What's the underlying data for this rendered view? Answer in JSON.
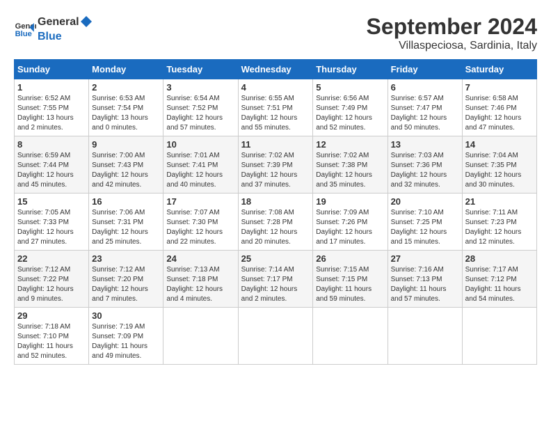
{
  "header": {
    "logo_general": "General",
    "logo_blue": "Blue",
    "month_year": "September 2024",
    "location": "Villaspeciosa, Sardinia, Italy"
  },
  "calendar": {
    "days_of_week": [
      "Sunday",
      "Monday",
      "Tuesday",
      "Wednesday",
      "Thursday",
      "Friday",
      "Saturday"
    ],
    "weeks": [
      [
        {
          "day": "1",
          "info": "Sunrise: 6:52 AM\nSunset: 7:55 PM\nDaylight: 13 hours\nand 2 minutes."
        },
        {
          "day": "2",
          "info": "Sunrise: 6:53 AM\nSunset: 7:54 PM\nDaylight: 13 hours\nand 0 minutes."
        },
        {
          "day": "3",
          "info": "Sunrise: 6:54 AM\nSunset: 7:52 PM\nDaylight: 12 hours\nand 57 minutes."
        },
        {
          "day": "4",
          "info": "Sunrise: 6:55 AM\nSunset: 7:51 PM\nDaylight: 12 hours\nand 55 minutes."
        },
        {
          "day": "5",
          "info": "Sunrise: 6:56 AM\nSunset: 7:49 PM\nDaylight: 12 hours\nand 52 minutes."
        },
        {
          "day": "6",
          "info": "Sunrise: 6:57 AM\nSunset: 7:47 PM\nDaylight: 12 hours\nand 50 minutes."
        },
        {
          "day": "7",
          "info": "Sunrise: 6:58 AM\nSunset: 7:46 PM\nDaylight: 12 hours\nand 47 minutes."
        }
      ],
      [
        {
          "day": "8",
          "info": "Sunrise: 6:59 AM\nSunset: 7:44 PM\nDaylight: 12 hours\nand 45 minutes."
        },
        {
          "day": "9",
          "info": "Sunrise: 7:00 AM\nSunset: 7:43 PM\nDaylight: 12 hours\nand 42 minutes."
        },
        {
          "day": "10",
          "info": "Sunrise: 7:01 AM\nSunset: 7:41 PM\nDaylight: 12 hours\nand 40 minutes."
        },
        {
          "day": "11",
          "info": "Sunrise: 7:02 AM\nSunset: 7:39 PM\nDaylight: 12 hours\nand 37 minutes."
        },
        {
          "day": "12",
          "info": "Sunrise: 7:02 AM\nSunset: 7:38 PM\nDaylight: 12 hours\nand 35 minutes."
        },
        {
          "day": "13",
          "info": "Sunrise: 7:03 AM\nSunset: 7:36 PM\nDaylight: 12 hours\nand 32 minutes."
        },
        {
          "day": "14",
          "info": "Sunrise: 7:04 AM\nSunset: 7:35 PM\nDaylight: 12 hours\nand 30 minutes."
        }
      ],
      [
        {
          "day": "15",
          "info": "Sunrise: 7:05 AM\nSunset: 7:33 PM\nDaylight: 12 hours\nand 27 minutes."
        },
        {
          "day": "16",
          "info": "Sunrise: 7:06 AM\nSunset: 7:31 PM\nDaylight: 12 hours\nand 25 minutes."
        },
        {
          "day": "17",
          "info": "Sunrise: 7:07 AM\nSunset: 7:30 PM\nDaylight: 12 hours\nand 22 minutes."
        },
        {
          "day": "18",
          "info": "Sunrise: 7:08 AM\nSunset: 7:28 PM\nDaylight: 12 hours\nand 20 minutes."
        },
        {
          "day": "19",
          "info": "Sunrise: 7:09 AM\nSunset: 7:26 PM\nDaylight: 12 hours\nand 17 minutes."
        },
        {
          "day": "20",
          "info": "Sunrise: 7:10 AM\nSunset: 7:25 PM\nDaylight: 12 hours\nand 15 minutes."
        },
        {
          "day": "21",
          "info": "Sunrise: 7:11 AM\nSunset: 7:23 PM\nDaylight: 12 hours\nand 12 minutes."
        }
      ],
      [
        {
          "day": "22",
          "info": "Sunrise: 7:12 AM\nSunset: 7:22 PM\nDaylight: 12 hours\nand 9 minutes."
        },
        {
          "day": "23",
          "info": "Sunrise: 7:12 AM\nSunset: 7:20 PM\nDaylight: 12 hours\nand 7 minutes."
        },
        {
          "day": "24",
          "info": "Sunrise: 7:13 AM\nSunset: 7:18 PM\nDaylight: 12 hours\nand 4 minutes."
        },
        {
          "day": "25",
          "info": "Sunrise: 7:14 AM\nSunset: 7:17 PM\nDaylight: 12 hours\nand 2 minutes."
        },
        {
          "day": "26",
          "info": "Sunrise: 7:15 AM\nSunset: 7:15 PM\nDaylight: 11 hours\nand 59 minutes."
        },
        {
          "day": "27",
          "info": "Sunrise: 7:16 AM\nSunset: 7:13 PM\nDaylight: 11 hours\nand 57 minutes."
        },
        {
          "day": "28",
          "info": "Sunrise: 7:17 AM\nSunset: 7:12 PM\nDaylight: 11 hours\nand 54 minutes."
        }
      ],
      [
        {
          "day": "29",
          "info": "Sunrise: 7:18 AM\nSunset: 7:10 PM\nDaylight: 11 hours\nand 52 minutes."
        },
        {
          "day": "30",
          "info": "Sunrise: 7:19 AM\nSunset: 7:09 PM\nDaylight: 11 hours\nand 49 minutes."
        },
        {
          "day": "",
          "info": ""
        },
        {
          "day": "",
          "info": ""
        },
        {
          "day": "",
          "info": ""
        },
        {
          "day": "",
          "info": ""
        },
        {
          "day": "",
          "info": ""
        }
      ]
    ]
  }
}
